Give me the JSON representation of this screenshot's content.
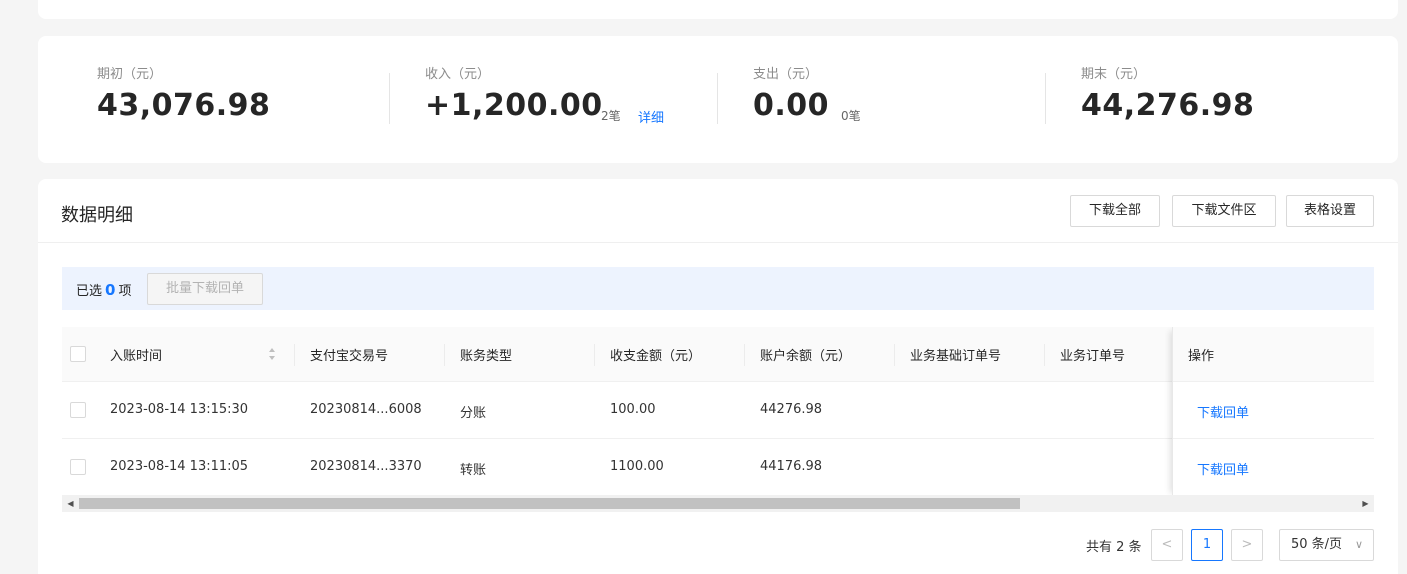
{
  "summary": {
    "opening": {
      "label": "期初（元）",
      "value": "43,076.98"
    },
    "income": {
      "label": "收入（元）",
      "value": "+1,200.00",
      "count": "2笔",
      "link": "详细"
    },
    "expense": {
      "label": "支出（元）",
      "value": "0.00",
      "count": "0笔"
    },
    "closing": {
      "label": "期末（元）",
      "value": "44,276.98"
    }
  },
  "detail": {
    "title": "数据明细",
    "buttons": {
      "download_all": "下载全部",
      "download_area": "下载文件区",
      "table_settings": "表格设置"
    },
    "selection": {
      "prefix": "已选",
      "count": "0",
      "suffix": "项",
      "batch_button": "批量下载回单"
    },
    "columns": [
      "入账时间",
      "支付宝交易号",
      "账务类型",
      "收支金额（元）",
      "账户余额（元）",
      "业务基础订单号",
      "业务订单号",
      "操作"
    ],
    "rows": [
      {
        "time": "2023-08-14 13:15:30",
        "trade_no": "20230814...6008",
        "type": "分账",
        "amount": "100.00",
        "balance": "44276.98",
        "base_order": "",
        "order": "",
        "action": "下载回单"
      },
      {
        "time": "2023-08-14 13:11:05",
        "trade_no": "20230814...3370",
        "type": "转账",
        "amount": "1100.00",
        "balance": "44176.98",
        "base_order": "",
        "order": "",
        "action": "下载回单"
      }
    ],
    "pagination": {
      "total": "共有 2 条",
      "current_page": "1",
      "prev": "<",
      "next": ">",
      "page_size": "50 条/页"
    }
  },
  "colors": {
    "accent": "#1677ff",
    "selection_bg": "#edf3fe"
  }
}
